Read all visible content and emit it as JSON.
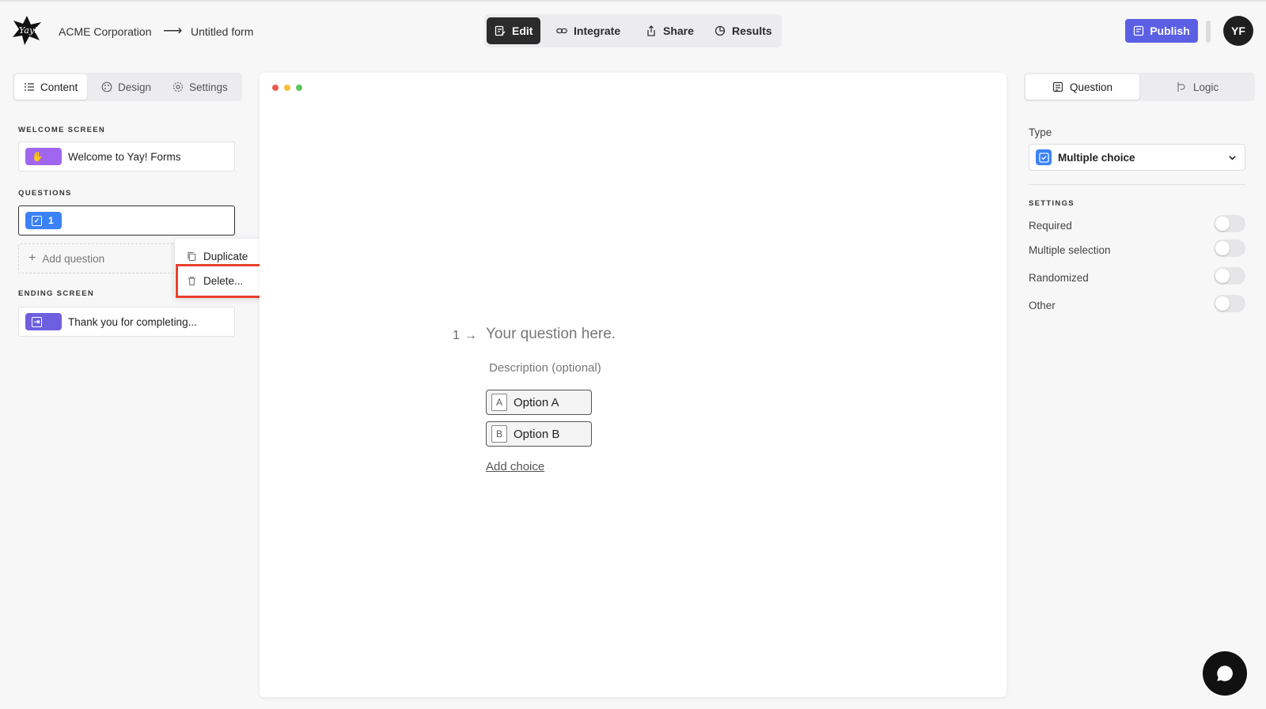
{
  "header": {
    "org": "ACME Corporation",
    "arrow": "⟶",
    "form_title": "Untitled form",
    "nav": [
      {
        "label": "Edit",
        "icon": "edit-icon"
      },
      {
        "label": "Integrate",
        "icon": "link-icon"
      },
      {
        "label": "Share",
        "icon": "share-icon"
      },
      {
        "label": "Results",
        "icon": "chart-icon"
      }
    ],
    "publish_label": "Publish",
    "avatar_initials": "YF"
  },
  "left_panel": {
    "tabs": [
      {
        "label": "Content",
        "icon": "list-icon"
      },
      {
        "label": "Design",
        "icon": "palette-icon"
      },
      {
        "label": "Settings",
        "icon": "gear-icon"
      }
    ],
    "welcome_section": "WELCOME SCREEN",
    "welcome_card": "Welcome to Yay! Forms",
    "questions_section": "QUESTIONS",
    "question_number": "1",
    "add_question": "Add question",
    "ending_section": "ENDING SCREEN",
    "ending_card": "Thank you for completing..."
  },
  "context_menu": {
    "duplicate": "Duplicate",
    "delete": "Delete..."
  },
  "canvas": {
    "question_number": "1",
    "arrow": "→",
    "question_title": "Your question here.",
    "description": "Description (optional)",
    "options": [
      {
        "key": "A",
        "label": "Option A"
      },
      {
        "key": "B",
        "label": "Option B"
      }
    ],
    "add_choice": "Add choice"
  },
  "right_panel": {
    "tabs": [
      {
        "label": "Question",
        "icon": "question-icon"
      },
      {
        "label": "Logic",
        "icon": "logic-icon"
      }
    ],
    "type_label": "Type",
    "type_value": "Multiple choice",
    "settings_section": "SETTINGS",
    "settings": [
      {
        "label": "Required",
        "on": false
      },
      {
        "label": "Multiple selection",
        "on": false
      },
      {
        "label": "Randomized",
        "on": false
      },
      {
        "label": "Other",
        "on": false
      }
    ]
  },
  "colors": {
    "accent": "#5b5fe3",
    "welcome_badge": "#a066f0",
    "question_badge": "#3b82f6",
    "ending_badge": "#6d5fe0",
    "highlight": "#e8412e"
  }
}
